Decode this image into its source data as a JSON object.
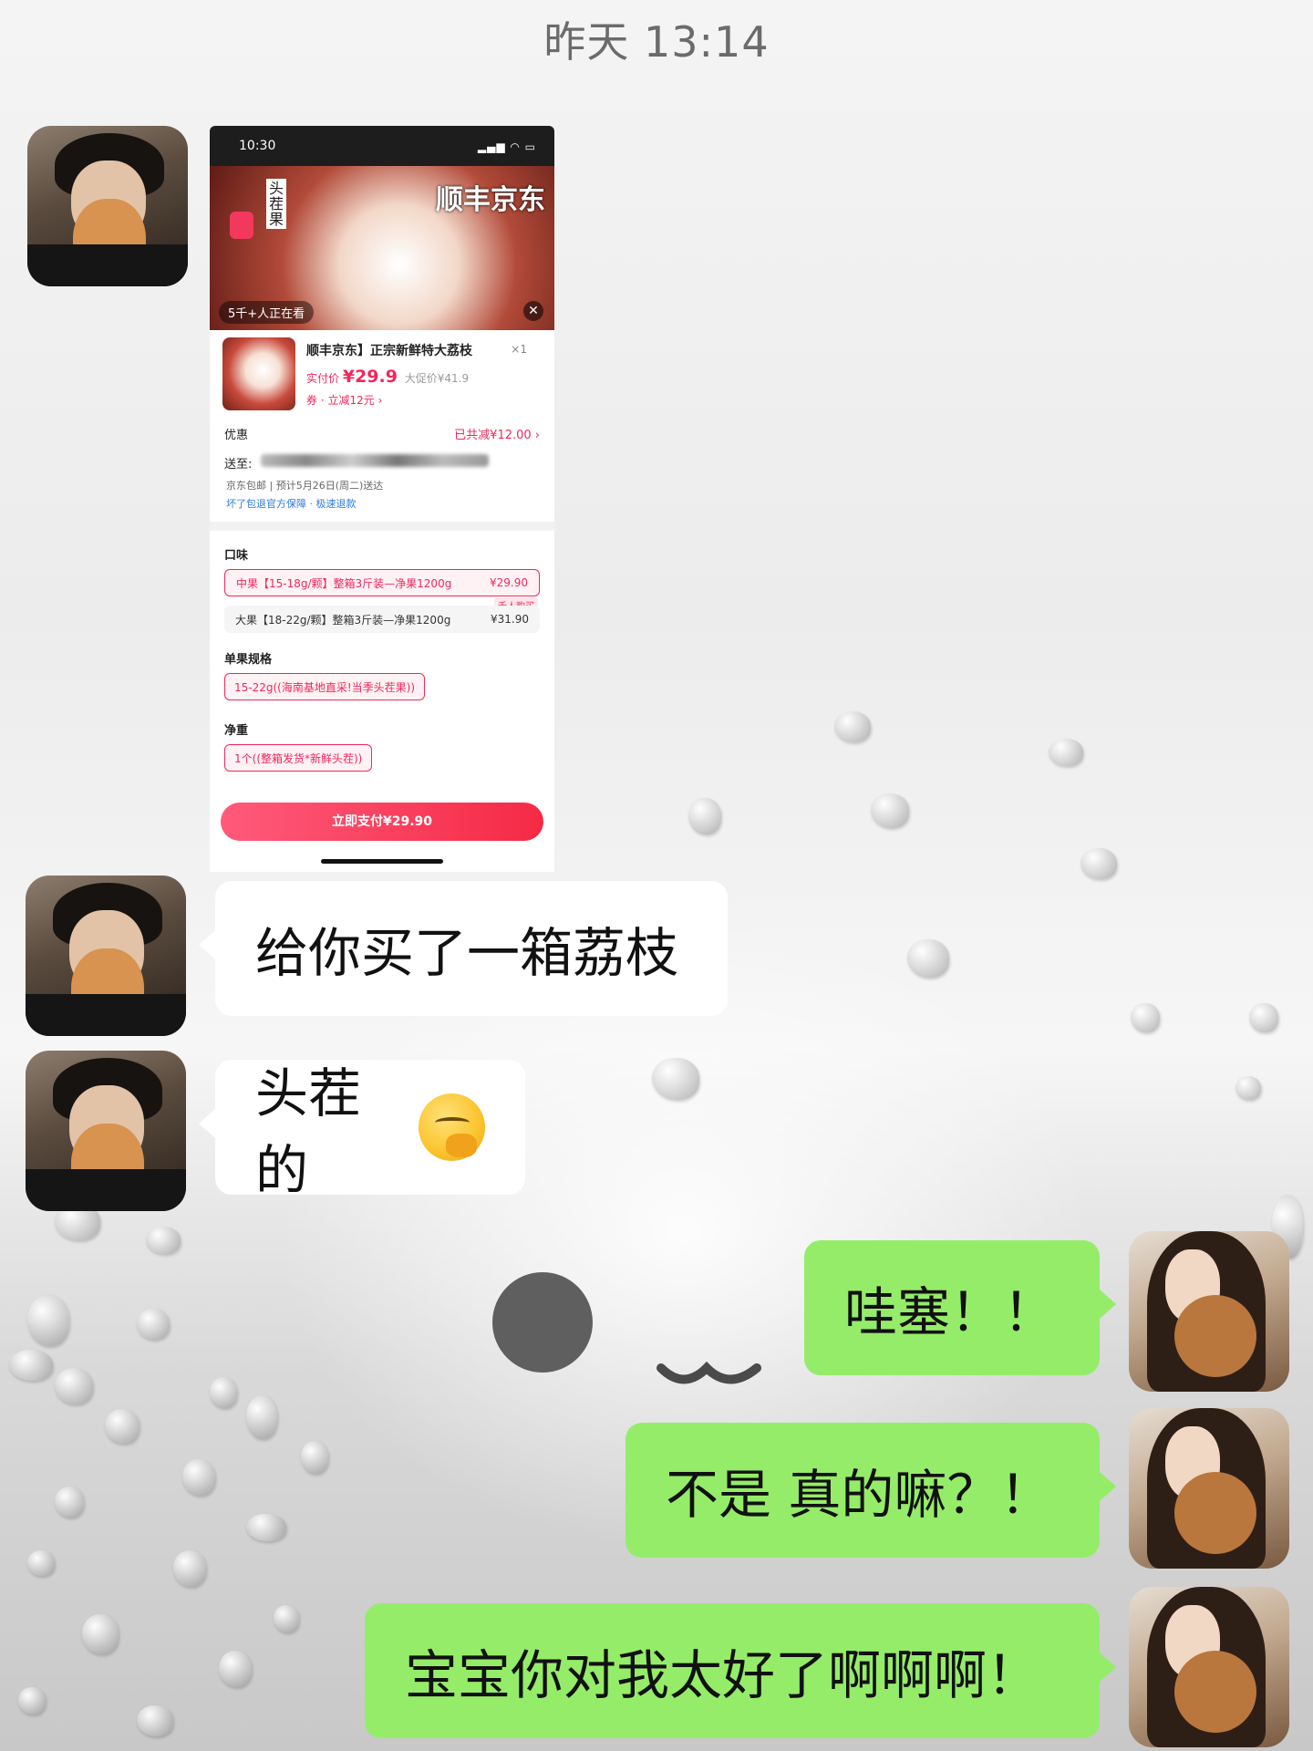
{
  "timestamp": "昨天 13:14",
  "screenshot": {
    "status_time": "10:30",
    "banner_logo": "顺丰京东",
    "banner_vertical_text": "头茬果",
    "viewers": "5千+人正在看",
    "product_name": "顺丰京东】正宗新鲜特大荔枝",
    "quantity": "×1",
    "price_label": "实付价",
    "price": "¥29.9",
    "promo_price": "大促价¥41.9",
    "coupon": "券 · 立减12元 ›",
    "discount_label": "优惠",
    "discount_value": "已共减¥12.00 ›",
    "ship_to_label": "送至:",
    "shipping_info": "京东包邮 | 预计5月26日(周二)送达",
    "guarantee": "坏了包退官方保障 · 极速退款",
    "flavor_label": "口味",
    "option_1": "中果【15-18g/颗】整箱3斤装—净果1200g",
    "option_1_price": "¥29.90",
    "option_2": "大果【18-22g/颗】整箱3斤装—净果1200g",
    "option_2_price": "¥31.90",
    "option_2_tag": "千人购买",
    "size_label": "单果规格",
    "size_value": "15-22g((海南基地直采!当季头茬果))",
    "weight_label": "净重",
    "weight_value": "1个((整箱发货*新鲜头茬))",
    "pay_button": "立即支付¥29.90"
  },
  "messages": [
    {
      "side": "in",
      "text": "给你买了一箱荔枝"
    },
    {
      "side": "in",
      "text": "头茬的",
      "emoji": "hand-over-mouth-emoji"
    },
    {
      "side": "out",
      "text": "哇塞！！"
    },
    {
      "side": "out",
      "text": "不是 真的嘛？！"
    },
    {
      "side": "out",
      "text": "宝宝你对我太好了啊啊啊！"
    }
  ],
  "colors": {
    "outgoing_bubble": "#95ec69",
    "incoming_bubble": "#ffffff",
    "accent_red": "#f2275b"
  }
}
